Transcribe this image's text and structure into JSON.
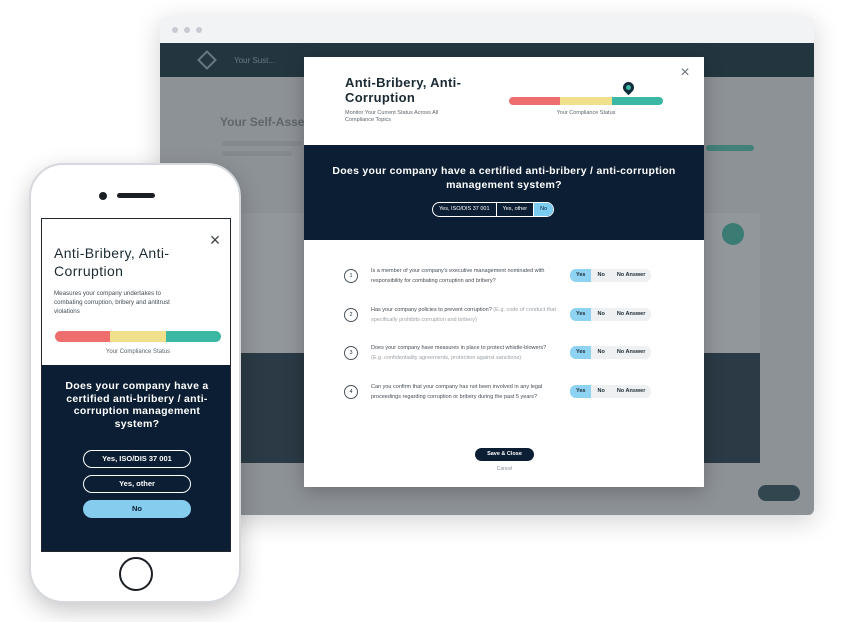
{
  "desktop": {
    "app_header": {
      "nav_text": "Your Sust..."
    },
    "background_title": "Your Self-Asse...",
    "modal": {
      "title": "Anti-Bribery, Anti-Corruption",
      "subtitle": "Monitor Your Current Status Across All Compliance Topics",
      "status_label": "Your Compliance Status",
      "question": "Does your company have a certified anti-bribery / anti-corruption management system?",
      "answer_options": [
        "Yes, ISO/DIS 37 001",
        "Yes, other",
        "No"
      ],
      "selected_answer": "No",
      "sub_questions": [
        {
          "number": "1",
          "text": "Is a member of your company's executive management nominated with responsibility for combating corruption and bribery?",
          "hint": "",
          "selected": "Yes"
        },
        {
          "number": "2",
          "text": "Has your company policies to prevent corruption?",
          "hint": "(E.g. code of conduct that specifically prohibits corruption and bribery)",
          "selected": "Yes"
        },
        {
          "number": "3",
          "text": "Does your company have measures in place to protect whistle-blowers?",
          "hint": "(E.g. confidentiality agreements, protection against sanctions)",
          "selected": "Yes"
        },
        {
          "number": "4",
          "text": "Can you confirm that your company has not been involved in any legal proceedings regarding corruption or bribery during the past 5 years?",
          "hint": "",
          "selected": "Yes"
        }
      ],
      "option_labels": [
        "Yes",
        "No",
        "No Answer"
      ],
      "save_label": "Save & Close",
      "cancel_label": "Cancel",
      "close_glyph": "×"
    }
  },
  "mobile": {
    "title": "Anti-Bribery, Anti-Corruption",
    "subtitle": "Measures your company undertakes to combating corruption, bribery and antitrust violations",
    "status_label": "Your Compliance Status",
    "question": "Does your company have a certified anti-bribery / anti-corruption management system?",
    "answer_options": [
      "Yes, ISO/DIS 37 001",
      "Yes, other",
      "No"
    ],
    "selected_answer": "No",
    "close_glyph": "×"
  },
  "colors": {
    "navy": "#0b1e33",
    "status_red": "#ee6e6e",
    "status_yellow": "#f0e08c",
    "status_teal": "#3bb8a3",
    "selected_blue": "#8fd3f2"
  },
  "icons": [
    "close-icon",
    "location-pin-icon",
    "logo-icon"
  ]
}
